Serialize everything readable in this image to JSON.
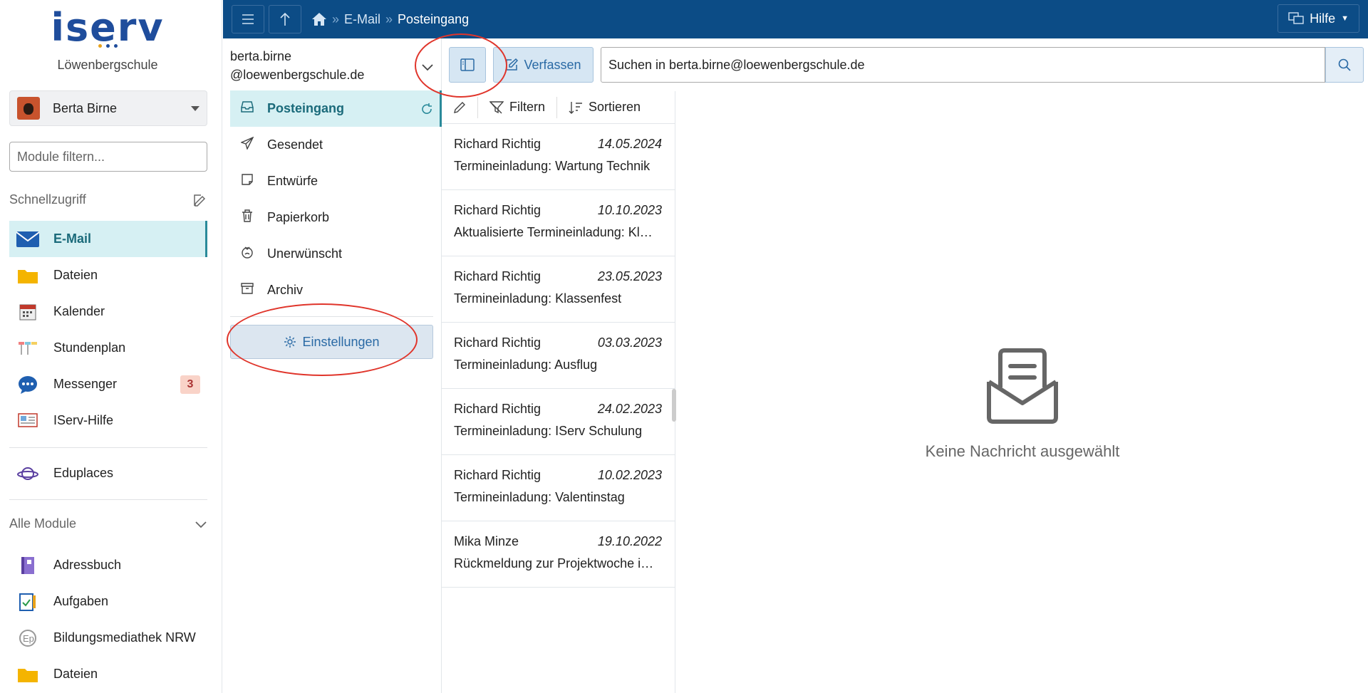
{
  "sidebar": {
    "logo_text": "iserv",
    "school_name": "Löwenbergschule",
    "user": {
      "name": "Berta Birne"
    },
    "module_filter_placeholder": "Module filtern...",
    "quick_access_title": "Schnellzugriff",
    "quick_access": [
      {
        "label": "E-Mail",
        "icon": "mail-icon"
      },
      {
        "label": "Dateien",
        "icon": "folder-icon"
      },
      {
        "label": "Kalender",
        "icon": "calendar-icon"
      },
      {
        "label": "Stundenplan",
        "icon": "timetable-icon"
      },
      {
        "label": "Messenger",
        "icon": "chat-icon",
        "badge": "3"
      },
      {
        "label": "IServ-Hilfe",
        "icon": "help-doc-icon"
      }
    ],
    "eduplaces_label": "Eduplaces",
    "all_modules_title": "Alle Module",
    "all_modules": [
      {
        "label": "Adressbuch",
        "icon": "addressbook-icon"
      },
      {
        "label": "Aufgaben",
        "icon": "tasks-icon"
      },
      {
        "label": "Bildungsmediathek NRW",
        "icon": "mediathek-icon"
      },
      {
        "label": "Dateien",
        "icon": "folder-icon"
      }
    ]
  },
  "topbar": {
    "breadcrumb": [
      "E-Mail",
      "Posteingang"
    ],
    "help_label": "Hilfe"
  },
  "mail": {
    "account_line1": "berta.birne",
    "account_line2": "@loewenbergschule.de",
    "folders": [
      {
        "label": "Posteingang",
        "icon": "inbox-icon"
      },
      {
        "label": "Gesendet",
        "icon": "sent-icon"
      },
      {
        "label": "Entwürfe",
        "icon": "drafts-icon"
      },
      {
        "label": "Papierkorb",
        "icon": "trash-icon"
      },
      {
        "label": "Unerwünscht",
        "icon": "spam-icon"
      },
      {
        "label": "Archiv",
        "icon": "archive-icon"
      }
    ],
    "settings_label": "Einstellungen",
    "compose_label": "Verfassen",
    "search_value": "Suchen in berta.birne@loewenbergschule.de",
    "filter_label": "Filtern",
    "sort_label": "Sortieren",
    "messages": [
      {
        "sender": "Richard Richtig",
        "date": "14.05.2024",
        "subject": "Termineinladung: Wartung Technik"
      },
      {
        "sender": "Richard Richtig",
        "date": "10.10.2023",
        "subject": "Aktualisierte Termineinladung: Kl…"
      },
      {
        "sender": "Richard Richtig",
        "date": "23.05.2023",
        "subject": "Termineinladung: Klassenfest"
      },
      {
        "sender": "Richard Richtig",
        "date": "03.03.2023",
        "subject": "Termineinladung: Ausflug"
      },
      {
        "sender": "Richard Richtig",
        "date": "24.02.2023",
        "subject": "Termineinladung: IServ Schulung"
      },
      {
        "sender": "Richard Richtig",
        "date": "10.02.2023",
        "subject": "Termineinladung: Valentinstag"
      },
      {
        "sender": "Mika Minze",
        "date": "19.10.2022",
        "subject": "Rückmeldung zur Projektwoche i…"
      }
    ],
    "empty_state": "Keine Nachricht ausgewählt"
  },
  "colors": {
    "topbar": "#0c4c86",
    "active_bg": "#d6f0f3",
    "annotation": "#e0352b"
  }
}
